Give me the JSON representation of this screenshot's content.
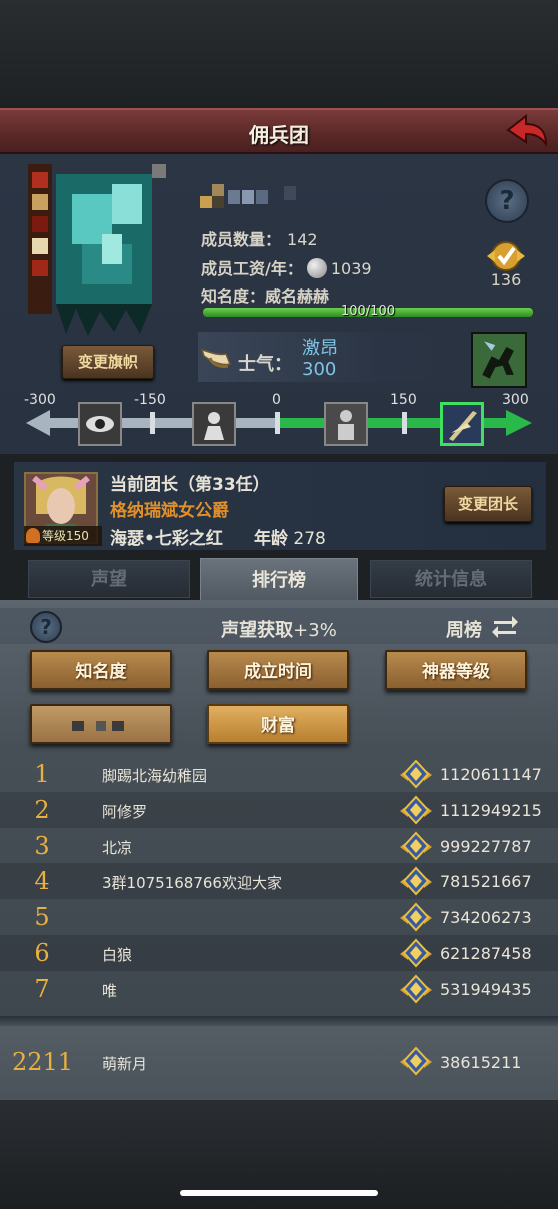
{
  "title": "佣兵团",
  "guild": {
    "members_label": "成员数量：",
    "members_value": "142",
    "salary_label": "成员工资/年：",
    "salary_value": "1039",
    "fame_label": "知名度：",
    "fame_value": "威名赫赫",
    "fame_progress_text": "100/100",
    "fame_progress_fraction": 1.0,
    "rank_number": "136",
    "change_banner_label": "变更旗帜",
    "help_symbol": "?"
  },
  "morale": {
    "label": "士气：",
    "state": "激昂",
    "value": "300",
    "scale_labels": [
      "-300",
      "-150",
      "0",
      "150",
      "300"
    ],
    "icons": [
      "eye-icon",
      "despair-icon",
      "neutral-icon",
      "rally-icon"
    ]
  },
  "leader": {
    "title": "当前团长（第33任）",
    "name": "格纳瑞斌女公爵",
    "hero": "海瑟•七彩之红",
    "age_label": "年龄",
    "age_value": "278",
    "level_text": "等级150",
    "change_leader_label": "变更团长"
  },
  "tabs": [
    {
      "label": "声望",
      "active": false
    },
    {
      "label": "排行榜",
      "active": true
    },
    {
      "label": "统计信息",
      "active": false
    }
  ],
  "ranking": {
    "bonus_label": "声望获取",
    "bonus_value": "+3%",
    "period_label": "周榜",
    "help_symbol": "?",
    "categories": [
      {
        "label": "知名度",
        "selected": false
      },
      {
        "label": "成立时间",
        "selected": false
      },
      {
        "label": "神器等级",
        "selected": false
      },
      {
        "label": "",
        "selected": false
      },
      {
        "label": "财富",
        "selected": true
      }
    ],
    "rows": [
      {
        "rank": "1",
        "name": "脚踢北海幼稚园",
        "value": "1120611147"
      },
      {
        "rank": "2",
        "name": "阿修罗",
        "value": "1112949215"
      },
      {
        "rank": "3",
        "name": "北凉",
        "value": "999227787"
      },
      {
        "rank": "4",
        "name": "3群1075168766欢迎大家",
        "value": "781521667"
      },
      {
        "rank": "5",
        "name": "",
        "value": "734206273"
      },
      {
        "rank": "6",
        "name": "白狼",
        "value": "621287458"
      },
      {
        "rank": "7",
        "name": "唯",
        "value": "531949435"
      }
    ],
    "my_row": {
      "rank": "2211",
      "name": "萌新月",
      "value": "38615211"
    }
  },
  "colors": {
    "title_bar": "#5a2828",
    "rank_number": "#e8b040",
    "leader_name": "#e0902a",
    "morale_text": "#7ec4e6",
    "button_gold": "#b88a4c",
    "progress_green": "#4ab83a"
  }
}
